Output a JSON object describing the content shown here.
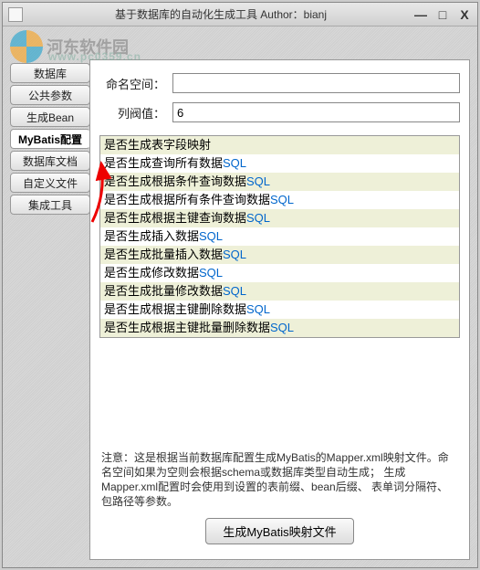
{
  "window": {
    "title": "基于数据库的自动化生成工具   Author：bianj",
    "min": "—",
    "max": "□",
    "close": "X"
  },
  "watermark": {
    "text": "河东软件园",
    "url": "www.pc0359.cn"
  },
  "sidebar": {
    "items": [
      {
        "label": "数据库"
      },
      {
        "label": "公共参数"
      },
      {
        "label": "生成Bean"
      },
      {
        "label": "MyBatis配置",
        "active": true
      },
      {
        "label": "数据库文档"
      },
      {
        "label": "自定义文件"
      },
      {
        "label": "集成工具"
      }
    ]
  },
  "form": {
    "namespace_label": "命名空间：",
    "namespace_value": "",
    "threshold_label": "列阀值：",
    "threshold_value": "6"
  },
  "options": [
    {
      "text": "是否生成表字段映射",
      "sql": ""
    },
    {
      "text": "是否生成查询所有数据",
      "sql": "SQL"
    },
    {
      "text": "是否生成根据条件查询数据",
      "sql": "SQL"
    },
    {
      "text": "是否生成根据所有条件查询数据",
      "sql": "SQL"
    },
    {
      "text": "是否生成根据主键查询数据",
      "sql": "SQL"
    },
    {
      "text": "是否生成插入数据",
      "sql": "SQL"
    },
    {
      "text": "是否生成批量插入数据",
      "sql": "SQL"
    },
    {
      "text": "是否生成修改数据",
      "sql": "SQL"
    },
    {
      "text": "是否生成批量修改数据",
      "sql": "SQL"
    },
    {
      "text": "是否生成根据主键删除数据",
      "sql": "SQL"
    },
    {
      "text": "是否生成根据主键批量删除数据",
      "sql": "SQL"
    }
  ],
  "notice": "注意：这是根据当前数据库配置生成MyBatis的Mapper.xml映射文件。命名空间如果为空则会根据schema或数据库类型自动生成；  生成Mapper.xml配置时会使用到设置的表前缀、bean后缀、 表单词分隔符、包路径等参数。",
  "button": {
    "generate": "生成MyBatis映射文件"
  }
}
